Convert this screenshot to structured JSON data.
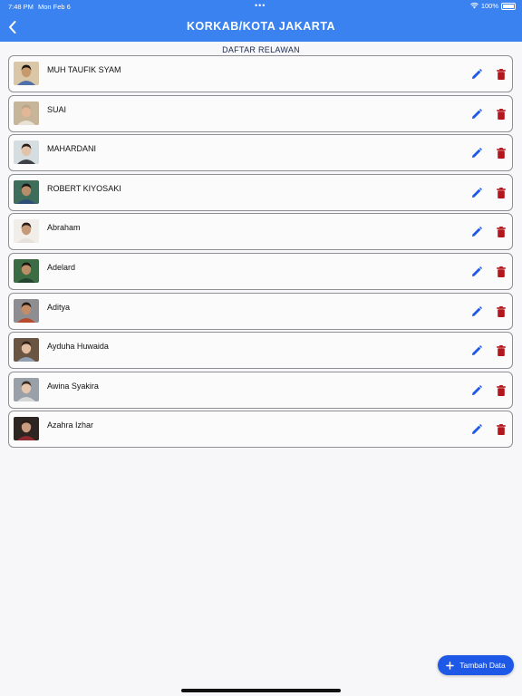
{
  "status_bar": {
    "time": "7:48 PM",
    "date": "Mon Feb 6",
    "battery": "100%"
  },
  "header": {
    "title": "KORKAB/KOTA JAKARTA",
    "back_icon": "chevron-left-icon"
  },
  "subtitle": "DAFTAR RELAWAN",
  "volunteers": [
    {
      "name": "MUH TAUFIK SYAM",
      "photo_bg": "#d9c7a8",
      "skin": "#c89a6b",
      "hair": "#1d1612",
      "shirt": "#4f6fa8"
    },
    {
      "name": "SUAI",
      "photo_bg": "#c7b59a",
      "skin": "#e1b796",
      "hair": "#b8a389",
      "shirt": "#e9e2d5"
    },
    {
      "name": "MAHARDANI",
      "photo_bg": "#d6dde0",
      "skin": "#e3c3a7",
      "hair": "#2a1d17",
      "shirt": "#3f4148"
    },
    {
      "name": "ROBERT KIYOSAKI",
      "photo_bg": "#3f6d5b",
      "skin": "#b98d6a",
      "hair": "#1a1512",
      "shirt": "#2f4e7a"
    },
    {
      "name": "Abraham",
      "photo_bg": "#f1eeea",
      "skin": "#c79a77",
      "hair": "#2a1d17",
      "shirt": "#e6e1da"
    },
    {
      "name": "Adelard",
      "photo_bg": "#3b6c44",
      "skin": "#bb8e68",
      "hair": "#1b1411",
      "shirt": "#24452f"
    },
    {
      "name": "Aditya",
      "photo_bg": "#8e8e92",
      "skin": "#c48c67",
      "hair": "#221812",
      "shirt": "#b84b2e"
    },
    {
      "name": "Ayduha Huwaida",
      "photo_bg": "#6a5543",
      "skin": "#e2bda0",
      "hair": "#2e211a",
      "shirt": "#8e9fb2"
    },
    {
      "name": "Awina Syakira",
      "photo_bg": "#9aa0a8",
      "skin": "#e6c5ad",
      "hair": "#3a2a20",
      "shirt": "#d5d6d8"
    },
    {
      "name": "Azahra Izhar",
      "photo_bg": "#2c2521",
      "skin": "#cb9c80",
      "hair": "#2a1d17",
      "shirt": "#8c2a30"
    }
  ],
  "actions": {
    "edit_icon": "pencil-icon",
    "delete_icon": "trash-icon"
  },
  "fab": {
    "label": "Tambah Data",
    "icon": "plus-icon"
  },
  "colors": {
    "appbar": "#3a82f0",
    "edit": "#1e58e6",
    "delete": "#b3161c",
    "fab": "#1e58e6"
  }
}
